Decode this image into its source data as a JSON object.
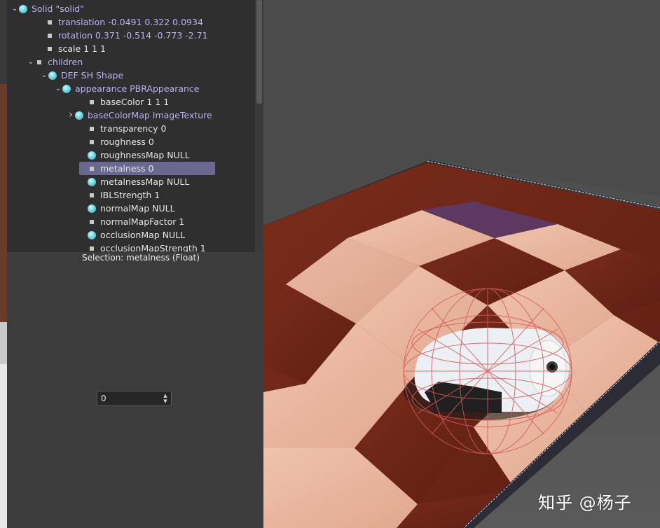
{
  "scene_tree": {
    "rows": [
      {
        "label": "Solid \"solid\"",
        "expander": "v",
        "bullet": "dot",
        "link": true
      },
      {
        "label": "translation -0.0491 0.322 0.0934",
        "expander": "",
        "bullet": "square",
        "link": true
      },
      {
        "label": "rotation 0.371 -0.514 -0.773 -2.71",
        "expander": "",
        "bullet": "square",
        "link": true
      },
      {
        "label": "scale 1 1 1",
        "expander": "",
        "bullet": "square",
        "link": false
      },
      {
        "label": "children",
        "expander": "v",
        "bullet": "square",
        "link": true
      },
      {
        "label": "DEF SH Shape",
        "expander": "v",
        "bullet": "dot",
        "link": true
      },
      {
        "label": "appearance PBRAppearance",
        "expander": "v",
        "bullet": "dot",
        "link": true
      },
      {
        "label": "baseColor 1 1 1",
        "expander": "",
        "bullet": "square",
        "link": false
      },
      {
        "label": "baseColorMap ImageTexture",
        "expander": ">",
        "bullet": "dot",
        "link": true
      },
      {
        "label": "transparency 0",
        "expander": "",
        "bullet": "square",
        "link": false
      },
      {
        "label": "roughness 0",
        "expander": "",
        "bullet": "square",
        "link": false
      },
      {
        "label": "roughnessMap NULL",
        "expander": "",
        "bullet": "dot",
        "link": false
      },
      {
        "label": "metalness 0",
        "expander": "",
        "bullet": "square",
        "link": false,
        "selected": true
      },
      {
        "label": "metalnessMap NULL",
        "expander": "",
        "bullet": "dot",
        "link": false
      },
      {
        "label": "IBLStrength 1",
        "expander": "",
        "bullet": "square",
        "link": false
      },
      {
        "label": "normalMap NULL",
        "expander": "",
        "bullet": "dot",
        "link": false
      },
      {
        "label": "normalMapFactor 1",
        "expander": "",
        "bullet": "square",
        "link": false
      },
      {
        "label": "occlusionMap NULL",
        "expander": "",
        "bullet": "dot",
        "link": false
      },
      {
        "label": "occlusionMapStrength 1",
        "expander": "",
        "bullet": "square",
        "link": false
      }
    ]
  },
  "field_editor": {
    "selection_text": "Selection: metalness (Float)",
    "value": "0",
    "spin_up": "▲",
    "spin_down": "▼"
  },
  "viewport": {
    "watermark": "知乎 @杨子"
  },
  "colors": {
    "panel_bg": "#2f2f2f",
    "link_text": "#b9b2f0",
    "selection_bg": "#6a6790",
    "node_dot": "#6fd7e0"
  }
}
